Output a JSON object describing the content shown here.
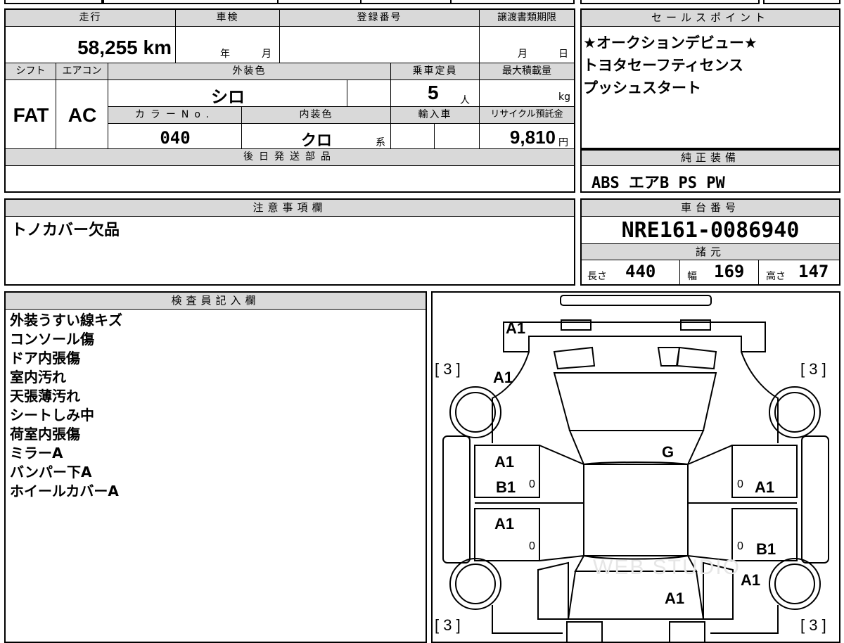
{
  "main": {
    "mileage_label": "走行",
    "mileage_value": "58,255 km",
    "inspection_label": "車検",
    "inspection_year": "年",
    "inspection_month": "月",
    "registration_label": "登録番号",
    "transfer_label": "譲渡書類期限",
    "transfer_month": "月",
    "transfer_day": "日",
    "shift_label": "シフト",
    "shift_value": "FAT",
    "ac_label": "エアコン",
    "ac_value": "AC",
    "exterior_label": "外装色",
    "exterior_value": "シロ",
    "capacity_label": "乗車定員",
    "capacity_value": "5",
    "capacity_unit": "人",
    "load_label": "最大積載量",
    "load_unit": "kg",
    "colorno_label": "カラーNo.",
    "colorno_value": "040",
    "interior_label": "内装色",
    "interior_value": "クロ",
    "interior_unit": "系",
    "import_label": "輸入車",
    "recycle_label": "リサイクル預託金",
    "recycle_value": "9,810",
    "recycle_unit": "円",
    "later_parts_label": "後日発送部品"
  },
  "sales": {
    "label": "セールスポイント",
    "lines": [
      "★オークションデビュー★",
      "トヨタセーフティセンス",
      "プッシュスタート"
    ]
  },
  "equipment": {
    "label": "純正装備",
    "value": "ABS エアB PS PW"
  },
  "notes": {
    "label": "注意事項欄",
    "value": "トノカバー欠品"
  },
  "chassis": {
    "label": "車台番号",
    "value": "NRE161-0086940",
    "specs_label": "諸元",
    "length_label": "長さ",
    "length_value": "440",
    "width_label": "幅",
    "width_value": "169",
    "height_label": "高さ",
    "height_value": "147"
  },
  "inspector": {
    "label": "検査員記入欄",
    "lines": [
      "外装うすい線キズ",
      "コンソール傷",
      "ドア内張傷",
      "室内汚れ",
      "天張薄汚れ",
      "シートしみ中",
      "荷室内張傷",
      "ミラーA",
      "バンパー下A",
      "ホイールカバーA"
    ]
  },
  "diagram": {
    "tire": "[ 3 ]",
    "zero": "0",
    "marks": {
      "front_bumper": "A1",
      "hood": "A1",
      "windshield": "G",
      "front_left_door": "A1",
      "front_left_door_2": "B1",
      "rear_left_door": "A1",
      "front_right_door": "A1",
      "rear_right_door": "B1",
      "rear_right_fender": "A1",
      "trunk": "A1"
    },
    "watermark": "WEB STUDIO"
  }
}
